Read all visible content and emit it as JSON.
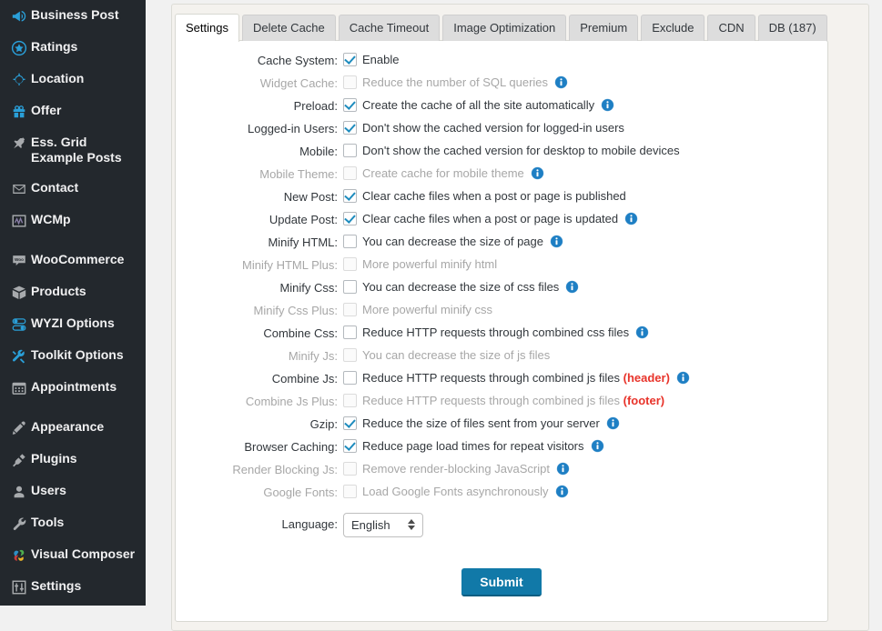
{
  "sidebar": {
    "items": [
      {
        "label": "Business Post",
        "icon": "megaphone-icon",
        "color": "blue"
      },
      {
        "label": "Ratings",
        "icon": "star-circle-icon",
        "color": "blue"
      },
      {
        "label": "Location",
        "icon": "location-target-icon",
        "color": "blue"
      },
      {
        "label": "Offer",
        "icon": "gift-icon",
        "color": "blue"
      },
      {
        "label": "Ess. Grid Example Posts",
        "icon": "pin-icon",
        "color": "gray"
      },
      {
        "label": "Contact",
        "icon": "envelope-icon",
        "color": "gray"
      },
      {
        "label": "WCMp",
        "icon": "chart-icon",
        "color": "gray"
      },
      {
        "separator": true
      },
      {
        "label": "WooCommerce",
        "icon": "woocommerce-icon",
        "color": "gray"
      },
      {
        "label": "Products",
        "icon": "products-box-icon",
        "color": "gray"
      },
      {
        "label": "WYZI Options",
        "icon": "toggles-icon",
        "color": "blue"
      },
      {
        "label": "Toolkit Options",
        "icon": "tools-cross-icon",
        "color": "blue"
      },
      {
        "label": "Appointments",
        "icon": "calendar-icon",
        "color": "gray"
      },
      {
        "separator": true
      },
      {
        "label": "Appearance",
        "icon": "paintbrush-icon",
        "color": "gray"
      },
      {
        "label": "Plugins",
        "icon": "plug-icon",
        "color": "gray"
      },
      {
        "label": "Users",
        "icon": "user-icon",
        "color": "gray"
      },
      {
        "label": "Tools",
        "icon": "wrench-icon",
        "color": "gray"
      },
      {
        "label": "Visual Composer",
        "icon": "visual-composer-icon",
        "color": "multicolor"
      },
      {
        "label": "Settings",
        "icon": "sliders-icon",
        "color": "gray"
      }
    ]
  },
  "tabs": [
    {
      "label": "Settings",
      "active": true
    },
    {
      "label": "Delete Cache",
      "active": false
    },
    {
      "label": "Cache Timeout",
      "active": false
    },
    {
      "label": "Image Optimization",
      "active": false
    },
    {
      "label": "Premium",
      "active": false
    },
    {
      "label": "Exclude",
      "active": false
    },
    {
      "label": "CDN",
      "active": false
    },
    {
      "label": "DB (187)",
      "active": false
    }
  ],
  "settings_rows": [
    {
      "label": "Cache System:",
      "description": "Enable",
      "checked": true,
      "disabled": false,
      "info": false
    },
    {
      "label": "Widget Cache:",
      "description": "Reduce the number of SQL queries",
      "checked": false,
      "disabled": true,
      "info": true
    },
    {
      "label": "Preload:",
      "description": "Create the cache of all the site automatically",
      "checked": true,
      "disabled": false,
      "info": true
    },
    {
      "label": "Logged-in Users:",
      "description": "Don't show the cached version for logged-in users",
      "checked": true,
      "disabled": false,
      "info": false
    },
    {
      "label": "Mobile:",
      "description": "Don't show the cached version for desktop to mobile devices",
      "checked": false,
      "disabled": false,
      "info": false
    },
    {
      "label": "Mobile Theme:",
      "description": "Create cache for mobile theme",
      "checked": false,
      "disabled": true,
      "info": true
    },
    {
      "label": "New Post:",
      "description": "Clear cache files when a post or page is published",
      "checked": true,
      "disabled": false,
      "info": false
    },
    {
      "label": "Update Post:",
      "description": "Clear cache files when a post or page is updated",
      "checked": true,
      "disabled": false,
      "info": true
    },
    {
      "label": "Minify HTML:",
      "description": "You can decrease the size of page",
      "checked": false,
      "disabled": false,
      "info": true
    },
    {
      "label": "Minify HTML Plus:",
      "description": "More powerful minify html",
      "checked": false,
      "disabled": true,
      "info": false
    },
    {
      "label": "Minify Css:",
      "description": "You can decrease the size of css files",
      "checked": false,
      "disabled": false,
      "info": true
    },
    {
      "label": "Minify Css Plus:",
      "description": "More powerful minify css",
      "checked": false,
      "disabled": true,
      "info": false
    },
    {
      "label": "Combine Css:",
      "description": "Reduce HTTP requests through combined css files",
      "checked": false,
      "disabled": false,
      "info": true
    },
    {
      "label": "Minify Js:",
      "description": "You can decrease the size of js files",
      "checked": false,
      "disabled": true,
      "info": false
    },
    {
      "label": "Combine Js:",
      "description": "Reduce HTTP requests through combined js files",
      "accent": "(header)",
      "checked": false,
      "disabled": false,
      "info": true
    },
    {
      "label": "Combine Js Plus:",
      "description": "Reduce HTTP requests through combined js files",
      "accent": "(footer)",
      "checked": false,
      "disabled": true,
      "info": false
    },
    {
      "label": "Gzip:",
      "description": "Reduce the size of files sent from your server",
      "checked": true,
      "disabled": false,
      "info": true
    },
    {
      "label": "Browser Caching:",
      "description": "Reduce page load times for repeat visitors",
      "checked": true,
      "disabled": false,
      "info": true
    },
    {
      "label": "Render Blocking Js:",
      "description": "Remove render-blocking JavaScript",
      "checked": false,
      "disabled": true,
      "info": true
    },
    {
      "label": "Google Fonts:",
      "description": "Load Google Fonts asynchronously",
      "checked": false,
      "disabled": true,
      "info": true
    }
  ],
  "language_row": {
    "label": "Language:",
    "value": "English",
    "options": [
      "English"
    ]
  },
  "submit": {
    "label": "Submit"
  },
  "colors": {
    "sidebar_bg": "#23282d",
    "accent_blue": "#1e8cbe",
    "icon_blue": "#2a9fd8",
    "submit_blue": "#1179a8",
    "red": "#e8332a",
    "info_blue": "#1e7fc4"
  }
}
